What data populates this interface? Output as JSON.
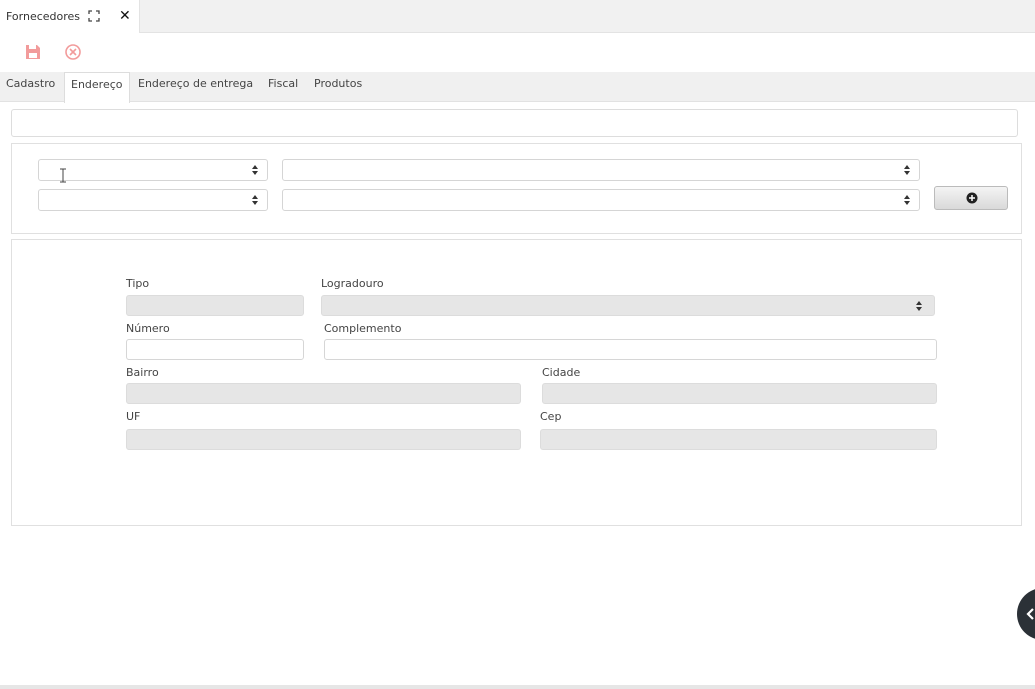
{
  "window": {
    "tab_title": "Fornecedores",
    "expand_icon": "expand-icon",
    "close_icon": "close-icon"
  },
  "toolbar": {
    "save_icon": "save-icon",
    "cancel_icon": "cancel-circle-icon",
    "accent_color": "#f08080"
  },
  "tabs": [
    {
      "label": "Cadastro",
      "active": false
    },
    {
      "label": "Endereço",
      "active": true
    },
    {
      "label": "Endereço de entrega",
      "active": false
    },
    {
      "label": "Fiscal",
      "active": false
    },
    {
      "label": "Produtos",
      "active": false
    }
  ],
  "filter": {
    "selects": [
      "",
      "",
      "",
      ""
    ],
    "add_icon": "plus-circle-icon"
  },
  "address_form": {
    "tipo_label": "Tipo",
    "tipo_value": "",
    "logradouro_label": "Logradouro",
    "logradouro_value": "",
    "numero_label": "Número",
    "numero_value": "",
    "complemento_label": "Complemento",
    "complemento_value": "",
    "bairro_label": "Bairro",
    "bairro_value": "",
    "cidade_label": "Cidade",
    "cidade_value": "",
    "uf_label": "UF",
    "uf_value": "",
    "cep_label": "Cep",
    "cep_value": ""
  },
  "floating": {
    "icon": "chevron-left-icon"
  }
}
